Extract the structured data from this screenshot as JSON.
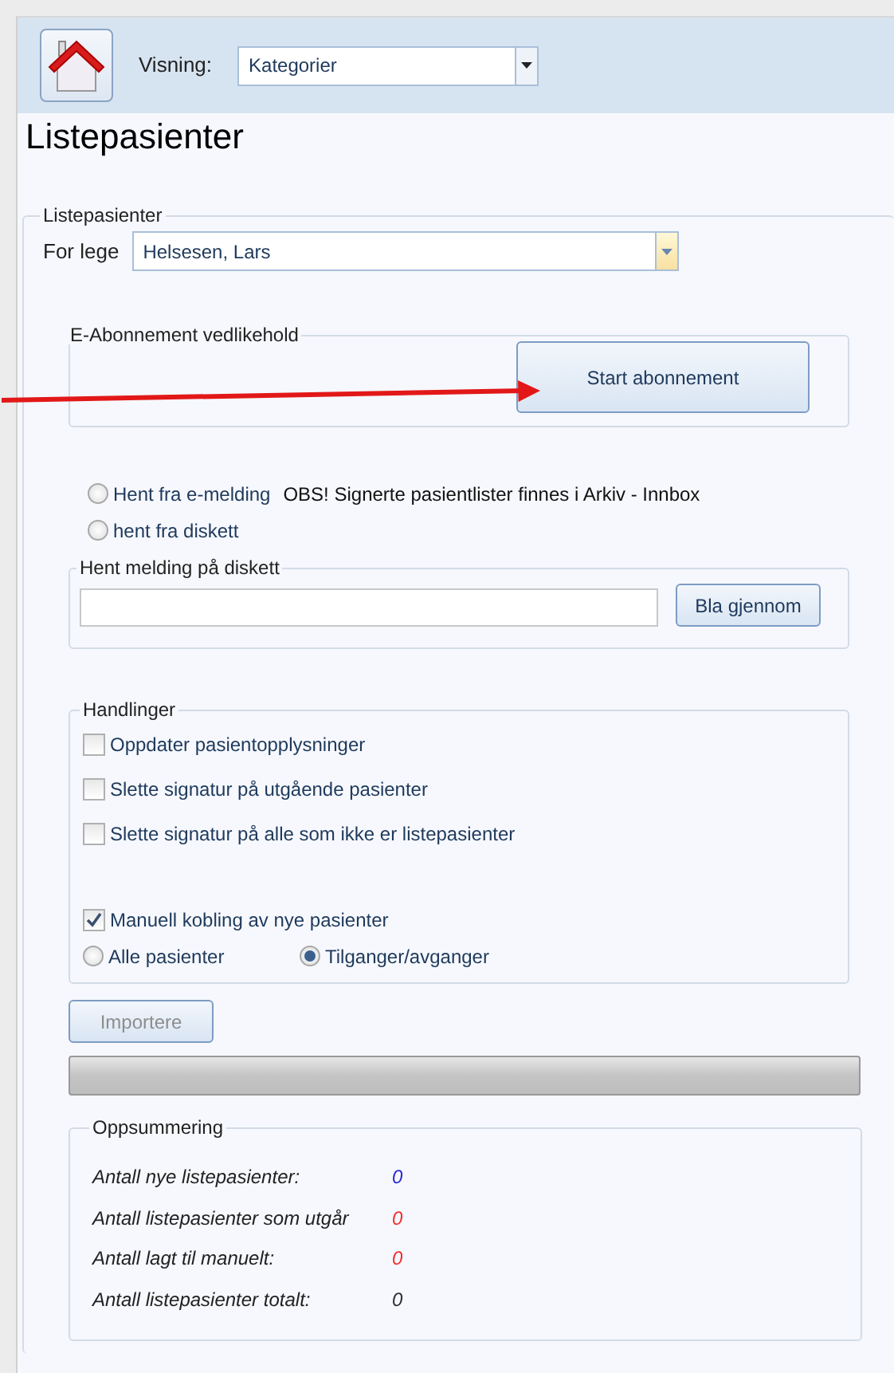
{
  "toolbar": {
    "view_label": "Visning:",
    "view_value": "Kategorier"
  },
  "title": "Listepasienter",
  "group": {
    "title": "Listepasienter",
    "doctor_label": "For lege",
    "doctor_value": "Helsesen, Lars",
    "subscription": {
      "title": "E-Abonnement vedlikehold",
      "button": "Start abonnement"
    },
    "sources": [
      {
        "label": "Hent fra e-melding",
        "selected": false
      },
      {
        "label": "hent fra diskett",
        "selected": false
      }
    ],
    "notice": "OBS! Signerte pasientlister finnes i Arkiv - Innbox",
    "diskette": {
      "title": "Hent melding på diskett",
      "browse_button": "Bla gjennom"
    },
    "actions": {
      "title": "Handlinger",
      "checkboxes": [
        {
          "label": "Oppdater pasientopplysninger",
          "checked": false
        },
        {
          "label": "Slette signatur på utgående pasienter",
          "checked": false
        },
        {
          "label": "Slette signatur på alle som ikke er listepasienter",
          "checked": false
        }
      ],
      "manual_link": {
        "label": "Manuell kobling av nye pasienter",
        "checked": true
      },
      "scope": [
        {
          "label": "Alle pasienter",
          "selected": false
        },
        {
          "label": "Tilganger/avganger",
          "selected": true
        }
      ]
    },
    "import_button": {
      "label": "Importere",
      "disabled": true
    },
    "progress": {
      "level": 0
    },
    "summary": {
      "title": "Oppsummering",
      "rows": [
        {
          "label": "Antall nye listepasienter:",
          "value": "0",
          "color": "#2b2bd6"
        },
        {
          "label": "Antall listepasienter som utgår",
          "value": "0",
          "color": "#f03030"
        },
        {
          "label": "Antall lagt til manuelt:",
          "value": "0",
          "color": "#f03030"
        },
        {
          "label": "Antall listepasienter totalt:",
          "value": "0",
          "color": "#303030"
        }
      ]
    }
  }
}
